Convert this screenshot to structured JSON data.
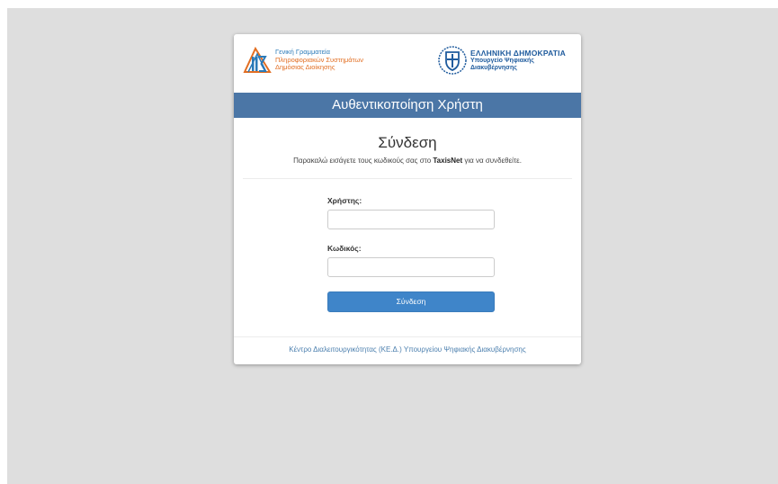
{
  "header": {
    "gsis_lines": [
      "Γενική Γραμματεία",
      "Πληροφοριακών Συστημάτων",
      "Δημόσιας Διοίκησης"
    ],
    "gov_title": "ΕΛΛΗΝΙΚΗ ΔΗΜΟΚΡΑΤΙΑ",
    "gov_ministry_lines": [
      "Υπουργείο Ψηφιακής",
      "Διακυβέρνησης"
    ]
  },
  "banner": {
    "title": "Αυθεντικοποίηση Χρήστη"
  },
  "login": {
    "heading": "Σύνδεση",
    "subtitle_prefix": "Παρακαλώ εισάγετε τους κωδικούς σας στο ",
    "subtitle_brand": "TaxisNet",
    "subtitle_suffix": " για να συνδεθείτε.",
    "username_label": "Χρήστης:",
    "username_value": "",
    "password_label": "Κωδικός:",
    "password_value": "",
    "submit_label": "Σύνδεση"
  },
  "footer": {
    "link_text": "Κέντρο Διαλειτουργικότητας (ΚΕ.Δ.) Υπουργείου Ψηφιακής Διακυβέρνησης"
  },
  "colors": {
    "banner": "#4b76a6",
    "button": "#3f85c9",
    "footer_link": "#4b7fae",
    "gsis_blue": "#2a7ab8",
    "gsis_orange": "#e26e22",
    "gov_blue": "#1f5b9d",
    "page_background": "#dedede"
  },
  "icons": {
    "gsis_logo": "gsis-logo-icon",
    "gov_emblem": "greek-emblem-icon"
  }
}
